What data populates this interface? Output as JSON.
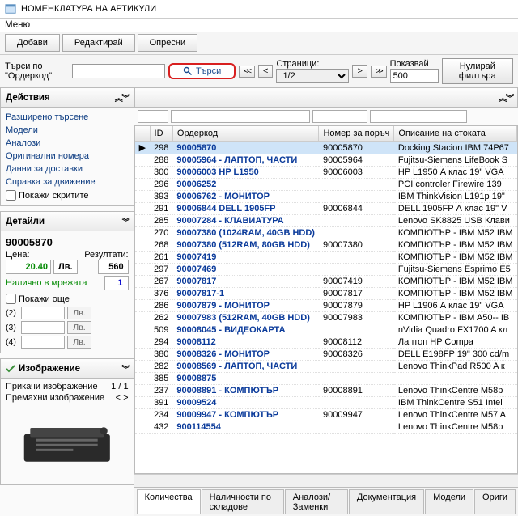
{
  "window": {
    "title": "НОМЕНКЛАТУРА НА АРТИКУЛИ"
  },
  "menu": {
    "label": "Меню"
  },
  "toolbar": {
    "add": "Добави",
    "edit": "Редактирай",
    "refresh": "Опресни"
  },
  "filter": {
    "label": "Търси по \"Ордеркод\"",
    "value": "",
    "search_btn": "Търси",
    "pages_label": "Страници:",
    "page_value": "1/2",
    "show_label": "Показвай",
    "show_value": "500",
    "reset": "Нулирай филтъра"
  },
  "actions": {
    "header": "Действия",
    "items": [
      "Разширено търсене",
      "Модели",
      "Аналози",
      "Оригинални номера",
      "Данни за доставки",
      "Справка за движение"
    ],
    "show_hidden": "Покажи скритите"
  },
  "details": {
    "header": "Детайли",
    "code": "90005870",
    "price_label": "Цена:",
    "price_value": "20.40",
    "lv": "Лв.",
    "results_label": "Резултати:",
    "results_value": "560",
    "avail_label": "Налично в мрежата",
    "avail_value": "1",
    "show_more": "Покажи още",
    "row_labels": [
      "(2)",
      "(3)",
      "(4)"
    ]
  },
  "image_panel": {
    "header": "Изображение",
    "attach": "Прикачи изображение",
    "attach_right": "1 / 1",
    "remove": "Премахни изображение",
    "remove_right": "<   >"
  },
  "grid": {
    "columns": [
      "",
      "ID",
      "Ордеркод",
      "Номер за поръч",
      "Описание на стоката"
    ],
    "rows": [
      {
        "sel": true,
        "id": "298",
        "oc": "90005870",
        "num": "90005870",
        "desc": "Docking Stacion IBM 74P67"
      },
      {
        "sel": false,
        "id": "288",
        "oc": "90005964 - ЛАПТОП, ЧАСТИ",
        "num": "90005964",
        "desc": "Fujitsu-Siemens LifeBook S"
      },
      {
        "sel": false,
        "id": "300",
        "oc": "90006003 HP L1950",
        "num": "90006003",
        "desc": "HP L1950 А клас 19\" VGA"
      },
      {
        "sel": false,
        "id": "296",
        "oc": "90006252",
        "num": "",
        "desc": "PCI controler Firewire 139"
      },
      {
        "sel": false,
        "id": "393",
        "oc": "90006762 - МОНИТОР",
        "num": "",
        "desc": "IBM ThinkVision L191p 19\""
      },
      {
        "sel": false,
        "id": "291",
        "oc": "90006844 DELL 1905FP",
        "num": "90006844",
        "desc": "DELL 1905FP А клас 19\" V"
      },
      {
        "sel": false,
        "id": "285",
        "oc": "90007284 - КЛАВИАТУРА",
        "num": "",
        "desc": "Lenovo SK8825 USB Клави"
      },
      {
        "sel": false,
        "id": "270",
        "oc": "90007380 (1024RAM, 40GB HDD)",
        "num": "",
        "desc": "КОМПЮТЪР - IBM M52 IBM"
      },
      {
        "sel": false,
        "id": "268",
        "oc": "90007380 (512RAM, 80GB HDD)",
        "num": "90007380",
        "desc": "КОМПЮТЪР - IBM M52 IBM"
      },
      {
        "sel": false,
        "id": "261",
        "oc": "90007419",
        "num": "",
        "desc": "КОМПЮТЪР - IBM M52 IBM"
      },
      {
        "sel": false,
        "id": "297",
        "oc": "90007469",
        "num": "",
        "desc": "Fujitsu-Siemens Esprimo E5"
      },
      {
        "sel": false,
        "id": "267",
        "oc": "90007817",
        "num": "90007419",
        "desc": "КОМПЮТЪР - IBM M52 IBM"
      },
      {
        "sel": false,
        "id": "376",
        "oc": "90007817-1",
        "num": "90007817",
        "desc": "КОМПЮТЪР - IBM M52 IBM"
      },
      {
        "sel": false,
        "id": "286",
        "oc": "90007879 - МОНИТОР",
        "num": "90007879",
        "desc": "HP L1906 А клас 19\" VGA"
      },
      {
        "sel": false,
        "id": "262",
        "oc": "90007983 (512RAM, 40GB HDD)",
        "num": "90007983",
        "desc": "КОМПЮТЪР - IBM A50-- IB"
      },
      {
        "sel": false,
        "id": "509",
        "oc": "90008045 - ВИДЕОКАРТА",
        "num": "",
        "desc": "nVidia Quadro FX1700 A кл"
      },
      {
        "sel": false,
        "id": "294",
        "oc": "90008112",
        "num": "90008112",
        "desc": "Лаптоп HP Compa"
      },
      {
        "sel": false,
        "id": "380",
        "oc": "90008326 - МОНИТОР",
        "num": "90008326",
        "desc": "DELL E198FP 19\" 300 cd/m"
      },
      {
        "sel": false,
        "id": "282",
        "oc": "90008569 - ЛАПТОП, ЧАСТИ",
        "num": "",
        "desc": "Lenovo ThinkPad R500 A к"
      },
      {
        "sel": false,
        "id": "385",
        "oc": "90008875",
        "num": "",
        "desc": ""
      },
      {
        "sel": false,
        "id": "237",
        "oc": "90008891 - КОМПЮТЪР",
        "num": "90008891",
        "desc": "Lenovo ThinkCentre M58p"
      },
      {
        "sel": false,
        "id": "391",
        "oc": "90009524",
        "num": "",
        "desc": "IBM ThinkCentre S51 Intel"
      },
      {
        "sel": false,
        "id": "234",
        "oc": "90009947 - КОМПЮТЪР",
        "num": "90009947",
        "desc": "Lenovo ThinkCentre M57 A"
      },
      {
        "sel": false,
        "id": "432",
        "oc": "900114554",
        "num": "",
        "desc": "Lenovo ThinkCentre M58p"
      }
    ]
  },
  "bottom_tabs": [
    "Количества",
    "Наличности по складове",
    "Аналози/Заменки",
    "Документация",
    "Модели",
    "Ориги"
  ]
}
